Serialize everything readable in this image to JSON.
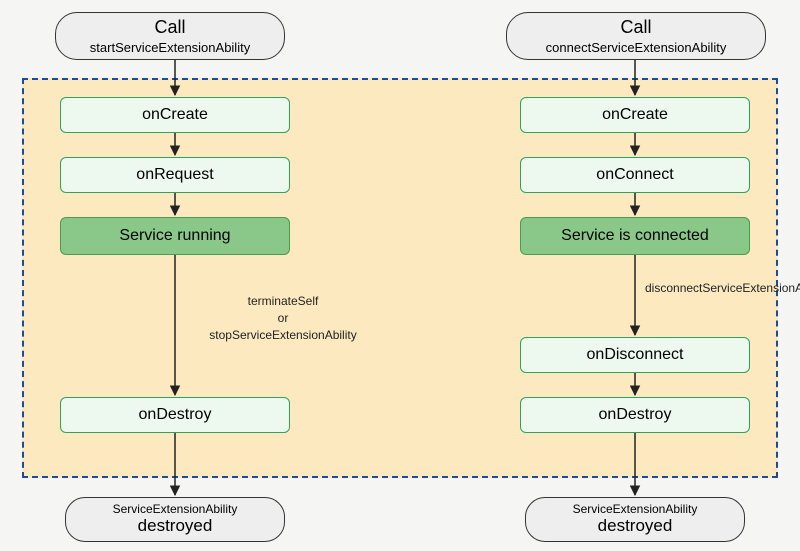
{
  "diagram": {
    "left": {
      "call": {
        "title": "Call",
        "sub": "startServiceExtensionAbility"
      },
      "onCreate": "onCreate",
      "onRequest": "onRequest",
      "running": "Service running",
      "terminateLabel": {
        "line1": "terminateSelf",
        "or": "or",
        "line2": "stopServiceExtensionAbility"
      },
      "onDestroy": "onDestroy",
      "destroyed": {
        "sub": "ServiceExtensionAbility",
        "title": "destroyed"
      }
    },
    "right": {
      "call": {
        "title": "Call",
        "sub": "connectServiceExtensionAbility"
      },
      "onCreate": "onCreate",
      "onConnect": "onConnect",
      "connected": "Service is connected",
      "disconnectLabel": "disconnectServiceExtensionAbility",
      "onDisconnect": "onDisconnect",
      "onDestroy": "onDestroy",
      "destroyed": {
        "sub": "ServiceExtensionAbility",
        "title": "destroyed"
      }
    }
  }
}
